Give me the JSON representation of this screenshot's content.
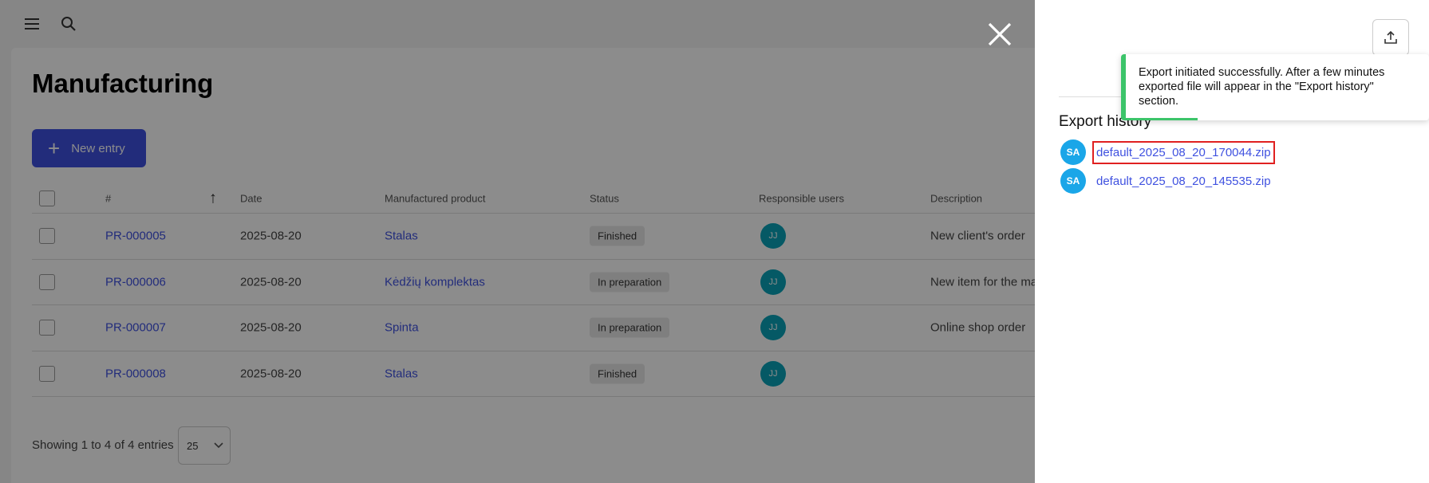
{
  "page": {
    "title": "Manufacturing"
  },
  "toolbar": {
    "new_entry_label": "New entry"
  },
  "table": {
    "headers": [
      "#",
      "Date",
      "Manufactured product",
      "Status",
      "Responsible users",
      "Description"
    ],
    "rows": [
      {
        "id": "PR-000005",
        "date": "2025-08-20",
        "product": "Stalas",
        "status": "Finished",
        "user": "JJ",
        "description": "New client's order"
      },
      {
        "id": "PR-000006",
        "date": "2025-08-20",
        "product": "Kėdžių komplektas",
        "status": "In preparation",
        "user": "JJ",
        "description": "New item for the ma"
      },
      {
        "id": "PR-000007",
        "date": "2025-08-20",
        "product": "Spinta",
        "status": "In preparation",
        "user": "JJ",
        "description": "Online shop order"
      },
      {
        "id": "PR-000008",
        "date": "2025-08-20",
        "product": "Stalas",
        "status": "Finished",
        "user": "JJ",
        "description": ""
      }
    ]
  },
  "footer": {
    "showing": "Showing 1 to 4 of 4 entries",
    "per_page": "25"
  },
  "panel": {
    "export_history_title": "Export history",
    "items": [
      {
        "user": "SA",
        "file": "default_2025_08_20_170044.zip"
      },
      {
        "user": "SA",
        "file": "default_2025_08_20_145535.zip"
      }
    ]
  },
  "toast": {
    "message": "Export initiated successfully. After a few minutes exported file will appear in the \"Export history\" section."
  },
  "icons": {
    "menu": "menu-icon",
    "search": "search-icon",
    "close": "close-icon",
    "upload": "upload-icon",
    "sort": "sort-ascending-icon",
    "dropdown": "chevron-down-icon",
    "plus": "plus-icon"
  },
  "colors": {
    "accent": "#3f51e0",
    "success": "#3cc46a",
    "avatar_jj": "#0aa3b8",
    "avatar_sa": "#1aa6e8",
    "highlight": "#e02020"
  }
}
